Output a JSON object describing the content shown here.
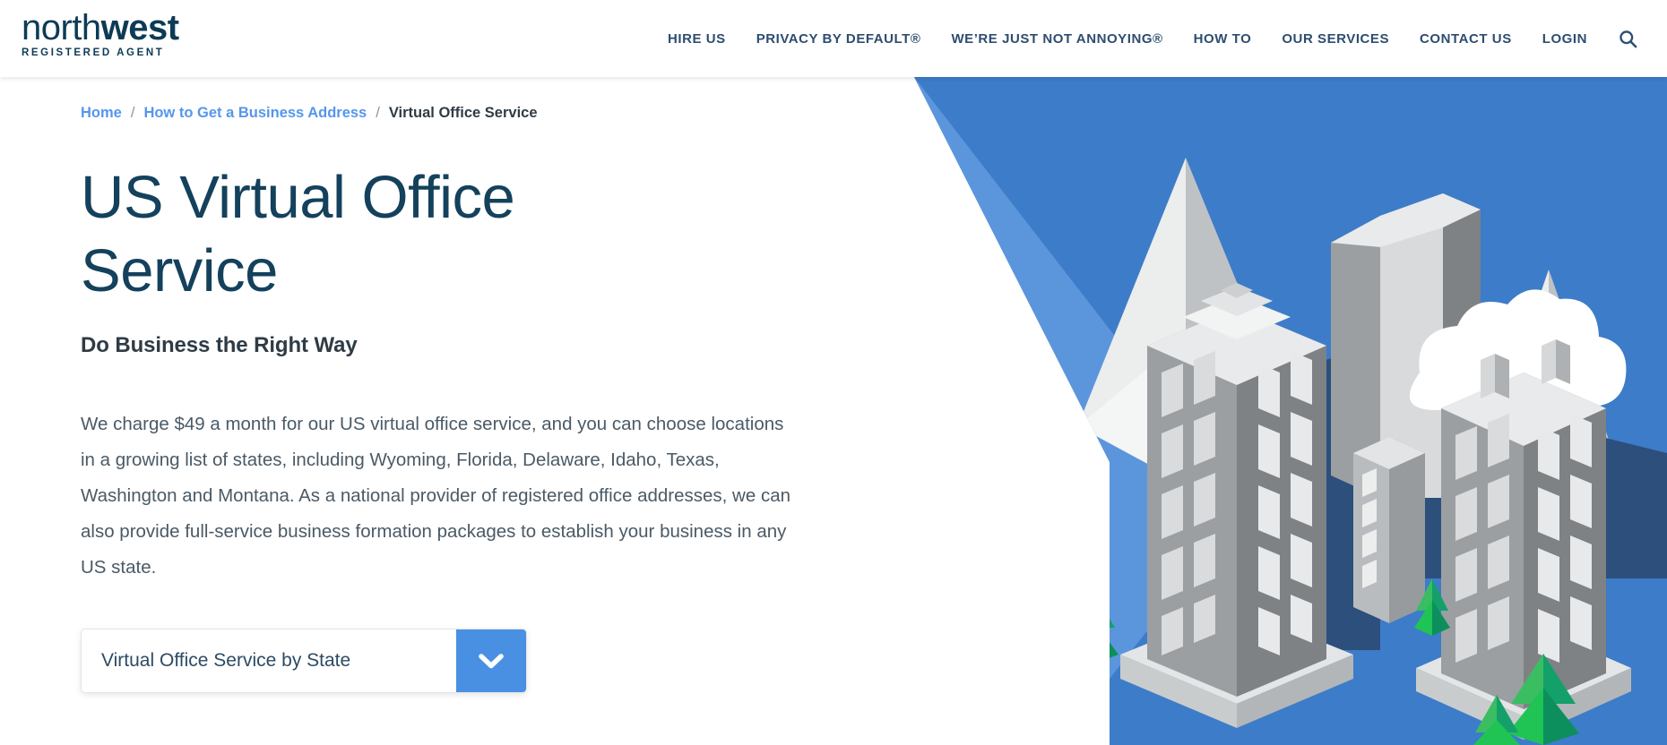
{
  "brand": {
    "logo_word_light": "north",
    "logo_word_bold": "west",
    "logo_subtitle": "REGISTERED AGENT"
  },
  "colors": {
    "navy": "#14415c",
    "nav_text": "#2e4d70",
    "link_blue": "#5596ec",
    "accent_blue": "#4a90e2",
    "hero_blue": "#3d7cc9",
    "hero_blue_light": "#5b96dd",
    "hero_blue_dark": "#2c4f7c",
    "tree_green_light": "#2ecc5f",
    "tree_green_dark": "#17a05a",
    "body_text": "#4a5a66"
  },
  "nav": {
    "items": [
      {
        "label": "HIRE US"
      },
      {
        "label": "PRIVACY BY DEFAULT®"
      },
      {
        "label": "WE’RE JUST NOT ANNOYING®"
      },
      {
        "label": "HOW TO"
      },
      {
        "label": "OUR SERVICES"
      },
      {
        "label": "CONTACT US"
      },
      {
        "label": "LOGIN"
      }
    ],
    "search_icon": "search-icon"
  },
  "breadcrumb": {
    "items": [
      {
        "label": "Home",
        "current": false
      },
      {
        "label": "How to Get a Business Address",
        "current": false
      },
      {
        "label": "Virtual Office Service",
        "current": true
      }
    ],
    "separator": "/"
  },
  "hero": {
    "title": "US Virtual Office Service",
    "subtitle": "Do Business the Right Way",
    "paragraph": "We charge $49 a month for our US virtual office service, and you can choose locations in a growing list of states, including Wyoming, Florida, Delaware, Idaho, Texas, Washington and Montana. As a national provider of registered office addresses, we can also provide full-service business formation packages to establish your business in any US state.",
    "illustration_name": "isometric-city-mountains-illustration"
  },
  "state_dropdown": {
    "label": "Virtual Office Service by State",
    "toggle_icon": "chevron-down-icon"
  }
}
